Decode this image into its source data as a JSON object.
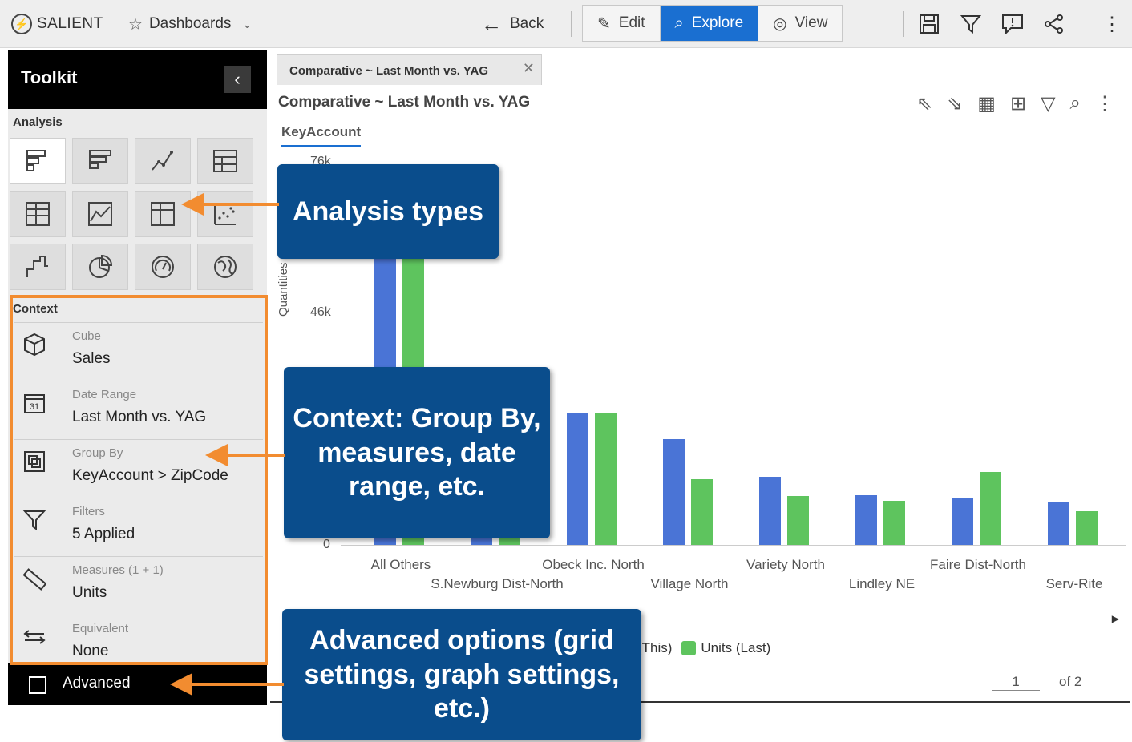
{
  "topbar": {
    "logo": "SALIENT",
    "dashboards": "Dashboards",
    "back": "Back",
    "modes": [
      {
        "label": "Edit",
        "icon": "pencil-icon"
      },
      {
        "label": "Explore",
        "icon": "explore-icon"
      },
      {
        "label": "View",
        "icon": "eye-icon"
      }
    ]
  },
  "toolkit": {
    "title": "Toolkit",
    "analysis_label": "Analysis",
    "context_label": "Context",
    "analysis_icons": [
      "bar-horizontal-icon",
      "bar-stacked-icon",
      "line-chart-icon",
      "grid-table-icon",
      "crosstab-icon",
      "area-chart-icon",
      "pivot-icon",
      "scatter-icon",
      "step-chart-icon",
      "pie-chart-icon",
      "gauge-icon",
      "map-icon"
    ],
    "context": [
      {
        "label": "Cube",
        "value": "Sales",
        "icon": "cube-icon"
      },
      {
        "label": "Date Range",
        "value": "Last Month vs. YAG",
        "icon": "calendar-icon"
      },
      {
        "label": "Group By",
        "value": "KeyAccount > ZipCode",
        "icon": "group-icon"
      },
      {
        "label": "Filters",
        "value": "5 Applied",
        "icon": "filter-icon"
      },
      {
        "label": "Measures (1 + 1)",
        "value": "Units",
        "icon": "ruler-icon"
      },
      {
        "label": "Equivalent",
        "value": "None",
        "icon": "equivalent-icon"
      }
    ],
    "advanced": "Advanced"
  },
  "tab": {
    "label": "Comparative ~ Last Month vs. YAG"
  },
  "panel": {
    "title": "Comparative ~ Last Month vs. YAG",
    "subtab": "KeyAccount",
    "pager_current": "1",
    "pager_total": "of 2"
  },
  "chart_data": {
    "type": "bar",
    "ylabel": "Quantities",
    "yticks": [
      "76k",
      "46k",
      "0"
    ],
    "ylim": [
      0,
      76000
    ],
    "categories": [
      "All Others",
      "S.Newburg Dist-North",
      "Obeck Inc. North",
      "Village North",
      "Variety North",
      "Lindley NE",
      "Faire Dist-North",
      "Serv-Rite"
    ],
    "series": [
      {
        "name": "Units (This)",
        "color": "#4a74d6",
        "values": [
          62000,
          30000,
          26000,
          21000,
          13500,
          9800,
          9200,
          8600
        ]
      },
      {
        "name": "Units (Last)",
        "color": "#5ec45e",
        "values": [
          60000,
          28000,
          26000,
          13000,
          9600,
          8700,
          14500,
          6600
        ]
      }
    ],
    "legend_visible": [
      "ts (This)",
      "Units (Last)"
    ]
  },
  "callouts": [
    {
      "text": "Analysis types"
    },
    {
      "text": "Context: Group By, measures, date range, etc."
    },
    {
      "text": "Advanced options (grid settings, graph settings, etc.)"
    }
  ]
}
